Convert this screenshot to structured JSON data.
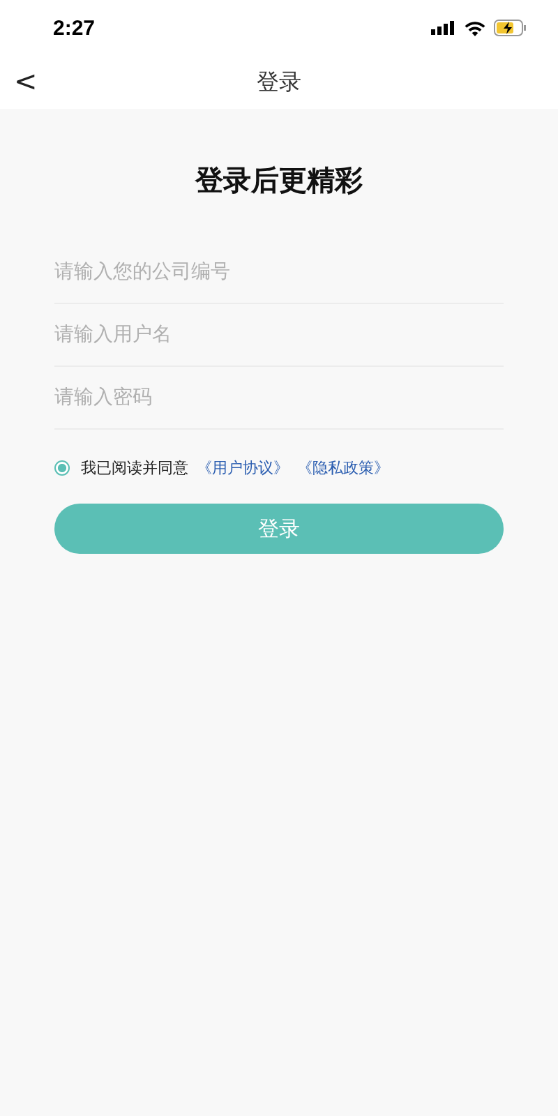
{
  "status_bar": {
    "time": "2:27"
  },
  "nav": {
    "back": "<",
    "title": "登录"
  },
  "heading": "登录后更精彩",
  "fields": [
    {
      "placeholder": "请输入您的公司编号"
    },
    {
      "placeholder": "请输入用户名"
    },
    {
      "placeholder": "请输入密码"
    }
  ],
  "agreement": {
    "checked": true,
    "text": "我已阅读并同意",
    "links": [
      "《用户协议》",
      "《隐私政策》"
    ]
  },
  "login_button": "登录"
}
